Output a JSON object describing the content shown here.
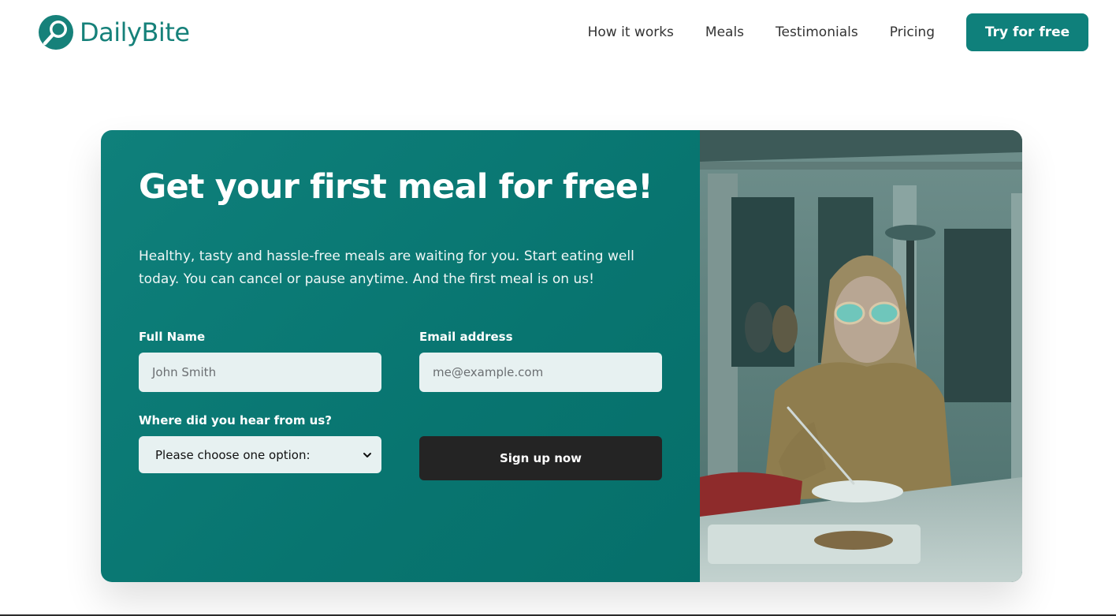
{
  "brand": {
    "name": "DailyBite",
    "color": "#16817a"
  },
  "nav": {
    "links": [
      "How it works",
      "Meals",
      "Testimonials",
      "Pricing"
    ],
    "cta_label": "Try for free"
  },
  "cta": {
    "title": "Get your first meal for free!",
    "description": "Healthy, tasty and hassle-free meals are waiting for you. Start eating well today. You can cancel or pause anytime. And the first meal is on us!",
    "form": {
      "name_label": "Full Name",
      "name_placeholder": "John Smith",
      "email_label": "Email address",
      "email_placeholder": "me@example.com",
      "source_label": "Where did you hear from us?",
      "source_selected": "Please choose one option:",
      "submit_label": "Sign up now"
    },
    "accent": "#0f807b",
    "button_color": "#242424"
  }
}
